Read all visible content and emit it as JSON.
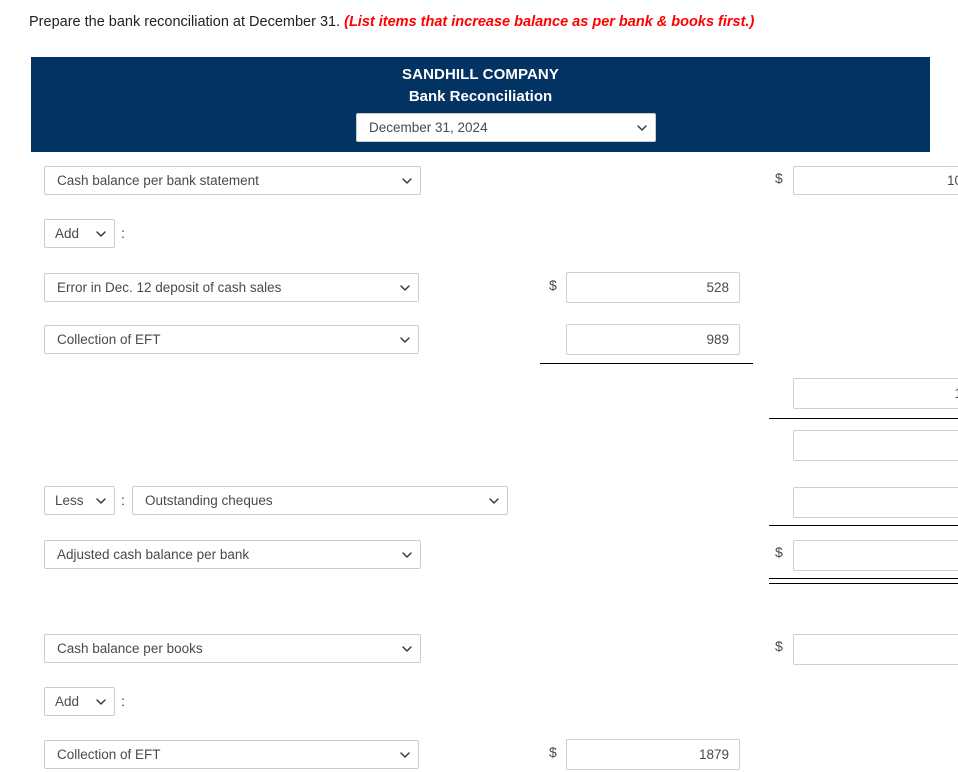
{
  "prompt": {
    "instruction": "Prepare the bank reconciliation at December 31.",
    "hint": "(List items that increase balance as per bank & books first.)"
  },
  "panel": {
    "company_name": "SANDHILL COMPANY",
    "report_title": "Bank Reconciliation",
    "date_value": "December 31, 2024",
    "header_color": "#033363"
  },
  "symbols": {
    "dollar": "$",
    "colon": ":"
  },
  "rows": {
    "bank_balance_label": "Cash balance per bank statement",
    "bank_balance_value": "10",
    "add_bank_label": "Add",
    "bank_add_item_1_label": "Error in Dec. 12 deposit of cash sales",
    "bank_add_item_1_value": "528",
    "bank_add_item_2_label": "Collection of EFT",
    "bank_add_item_2_value": "989",
    "bank_add_subtotal_value": "1",
    "bank_blank_1_value": "",
    "less_bank_label": "Less",
    "less_bank_item_label": "Outstanding cheques",
    "less_bank_item_value": "",
    "adjusted_bank_label": "Adjusted cash balance per bank",
    "adjusted_bank_value": "",
    "books_balance_label": "Cash balance per books",
    "books_balance_value": "",
    "add_books_label": "Add",
    "books_add_item_1_label": "Collection of EFT",
    "books_add_item_1_value": "1879"
  }
}
